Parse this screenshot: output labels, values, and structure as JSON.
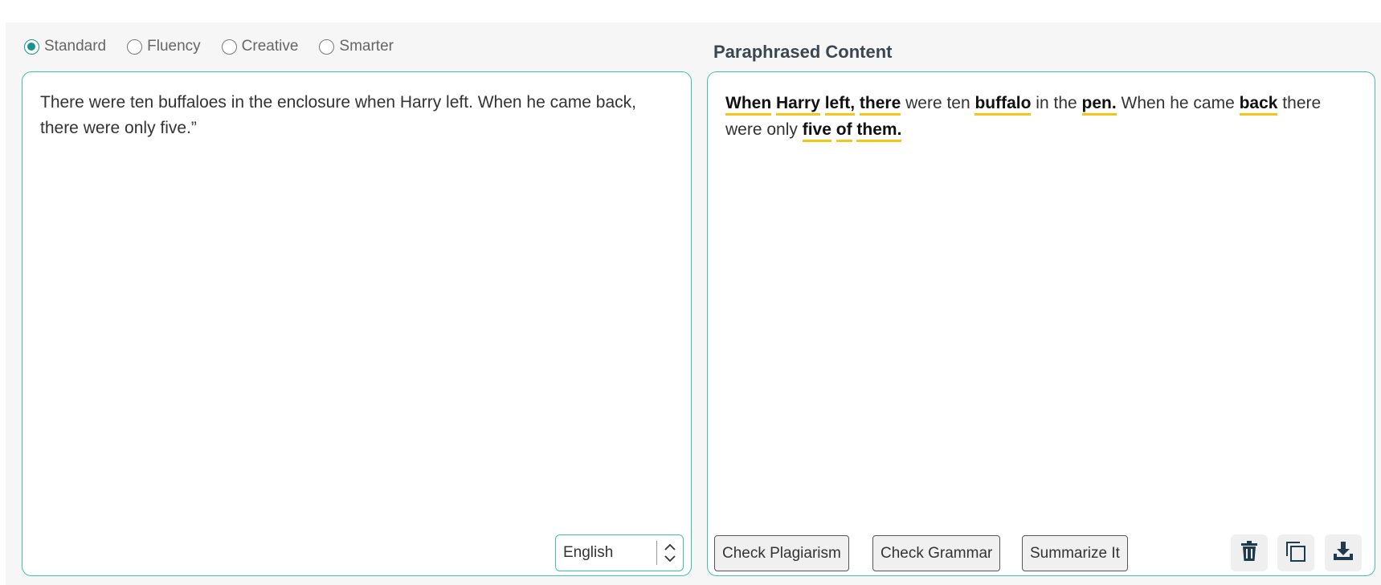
{
  "modes": [
    {
      "label": "Standard",
      "selected": true
    },
    {
      "label": "Fluency",
      "selected": false
    },
    {
      "label": "Creative",
      "selected": false
    },
    {
      "label": "Smarter",
      "selected": false
    }
  ],
  "output_title": "Paraphrased Content",
  "input": {
    "text": "There were ten buffaloes in the enclosure when Harry left. When he came back, there were only five.”"
  },
  "output": {
    "segments": [
      {
        "text": "When",
        "changed": true
      },
      {
        "text": " ",
        "changed": false
      },
      {
        "text": "Harry",
        "changed": true
      },
      {
        "text": " ",
        "changed": false
      },
      {
        "text": "left,",
        "changed": true
      },
      {
        "text": " ",
        "changed": false
      },
      {
        "text": "there",
        "changed": true
      },
      {
        "text": " were ten ",
        "changed": false
      },
      {
        "text": "buffalo",
        "changed": true
      },
      {
        "text": " in the ",
        "changed": false
      },
      {
        "text": "pen.",
        "changed": true
      },
      {
        "text": " When he came ",
        "changed": false
      },
      {
        "text": "back",
        "changed": true
      },
      {
        "text": " there were only ",
        "changed": false
      },
      {
        "text": "five",
        "changed": true
      },
      {
        "text": " ",
        "changed": false
      },
      {
        "text": "of",
        "changed": true
      },
      {
        "text": " ",
        "changed": false
      },
      {
        "text": "them.",
        "changed": true
      }
    ]
  },
  "language": {
    "selected": "English"
  },
  "actions": {
    "check_plagiarism": "Check Plagiarism",
    "check_grammar": "Check Grammar",
    "summarize": "Summarize It"
  },
  "icons": {
    "delete": "trash-icon",
    "copy": "copy-icon",
    "download": "download-icon"
  },
  "colors": {
    "accent": "#17948a",
    "border": "#3cc4a4",
    "highlight": "#f5c518",
    "icon": "#1e3a4c"
  }
}
